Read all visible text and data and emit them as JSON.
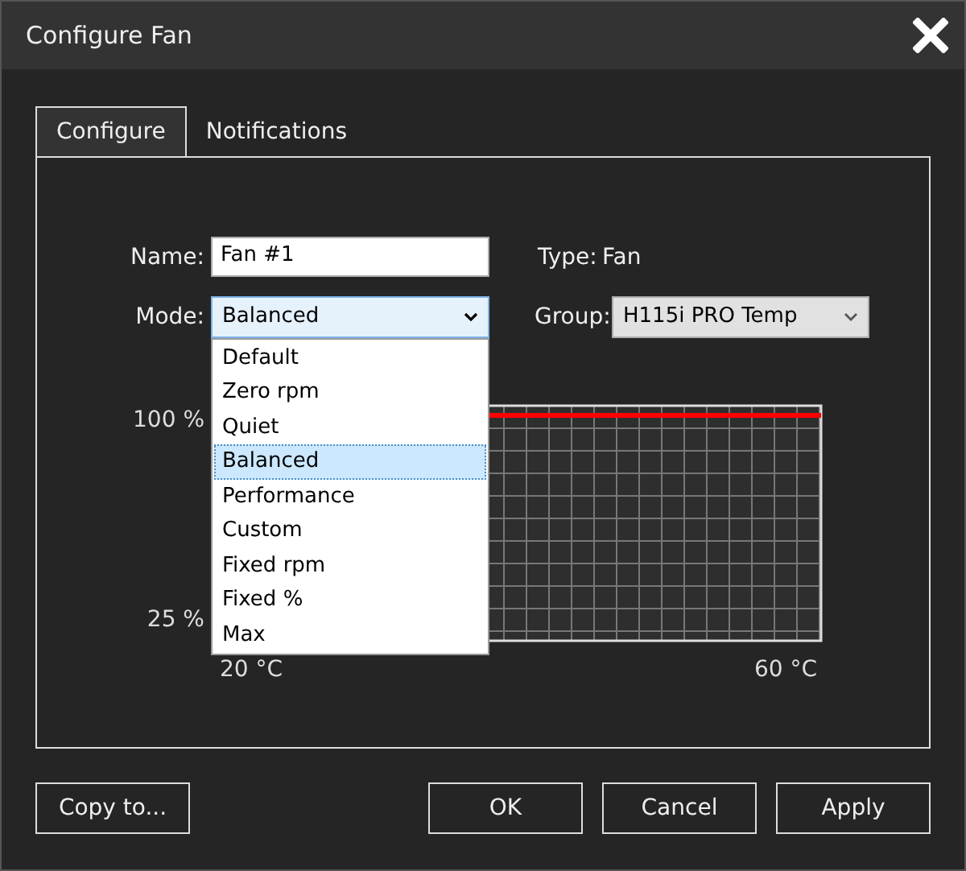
{
  "window": {
    "title": "Configure Fan"
  },
  "tabs": [
    {
      "label": "Configure",
      "selected": true
    },
    {
      "label": "Notifications",
      "selected": false
    }
  ],
  "form": {
    "name_label": "Name:",
    "name_value": "Fan #1",
    "type_label": "Type:",
    "type_value": "Fan",
    "mode_label": "Mode:",
    "mode_value": "Balanced",
    "group_label": "Group:",
    "group_value": "H115i PRO  Temp"
  },
  "mode_dropdown": {
    "expanded": true,
    "options": [
      {
        "label": "Default",
        "selected": false
      },
      {
        "label": "Zero rpm",
        "selected": false
      },
      {
        "label": "Quiet",
        "selected": false
      },
      {
        "label": "Balanced",
        "selected": true
      },
      {
        "label": "Performance",
        "selected": false
      },
      {
        "label": "Custom",
        "selected": false
      },
      {
        "label": "Fixed rpm",
        "selected": false
      },
      {
        "label": "Fixed %",
        "selected": false
      },
      {
        "label": "Max",
        "selected": false
      }
    ]
  },
  "curve": {
    "y_labels": [
      "100 %",
      "25 %"
    ],
    "x_labels": [
      "20 °C",
      "60 °C"
    ]
  },
  "buttons": [
    {
      "label": "Copy to..."
    },
    {
      "label": "OK"
    },
    {
      "label": "Cancel"
    },
    {
      "label": "Apply"
    }
  ]
}
